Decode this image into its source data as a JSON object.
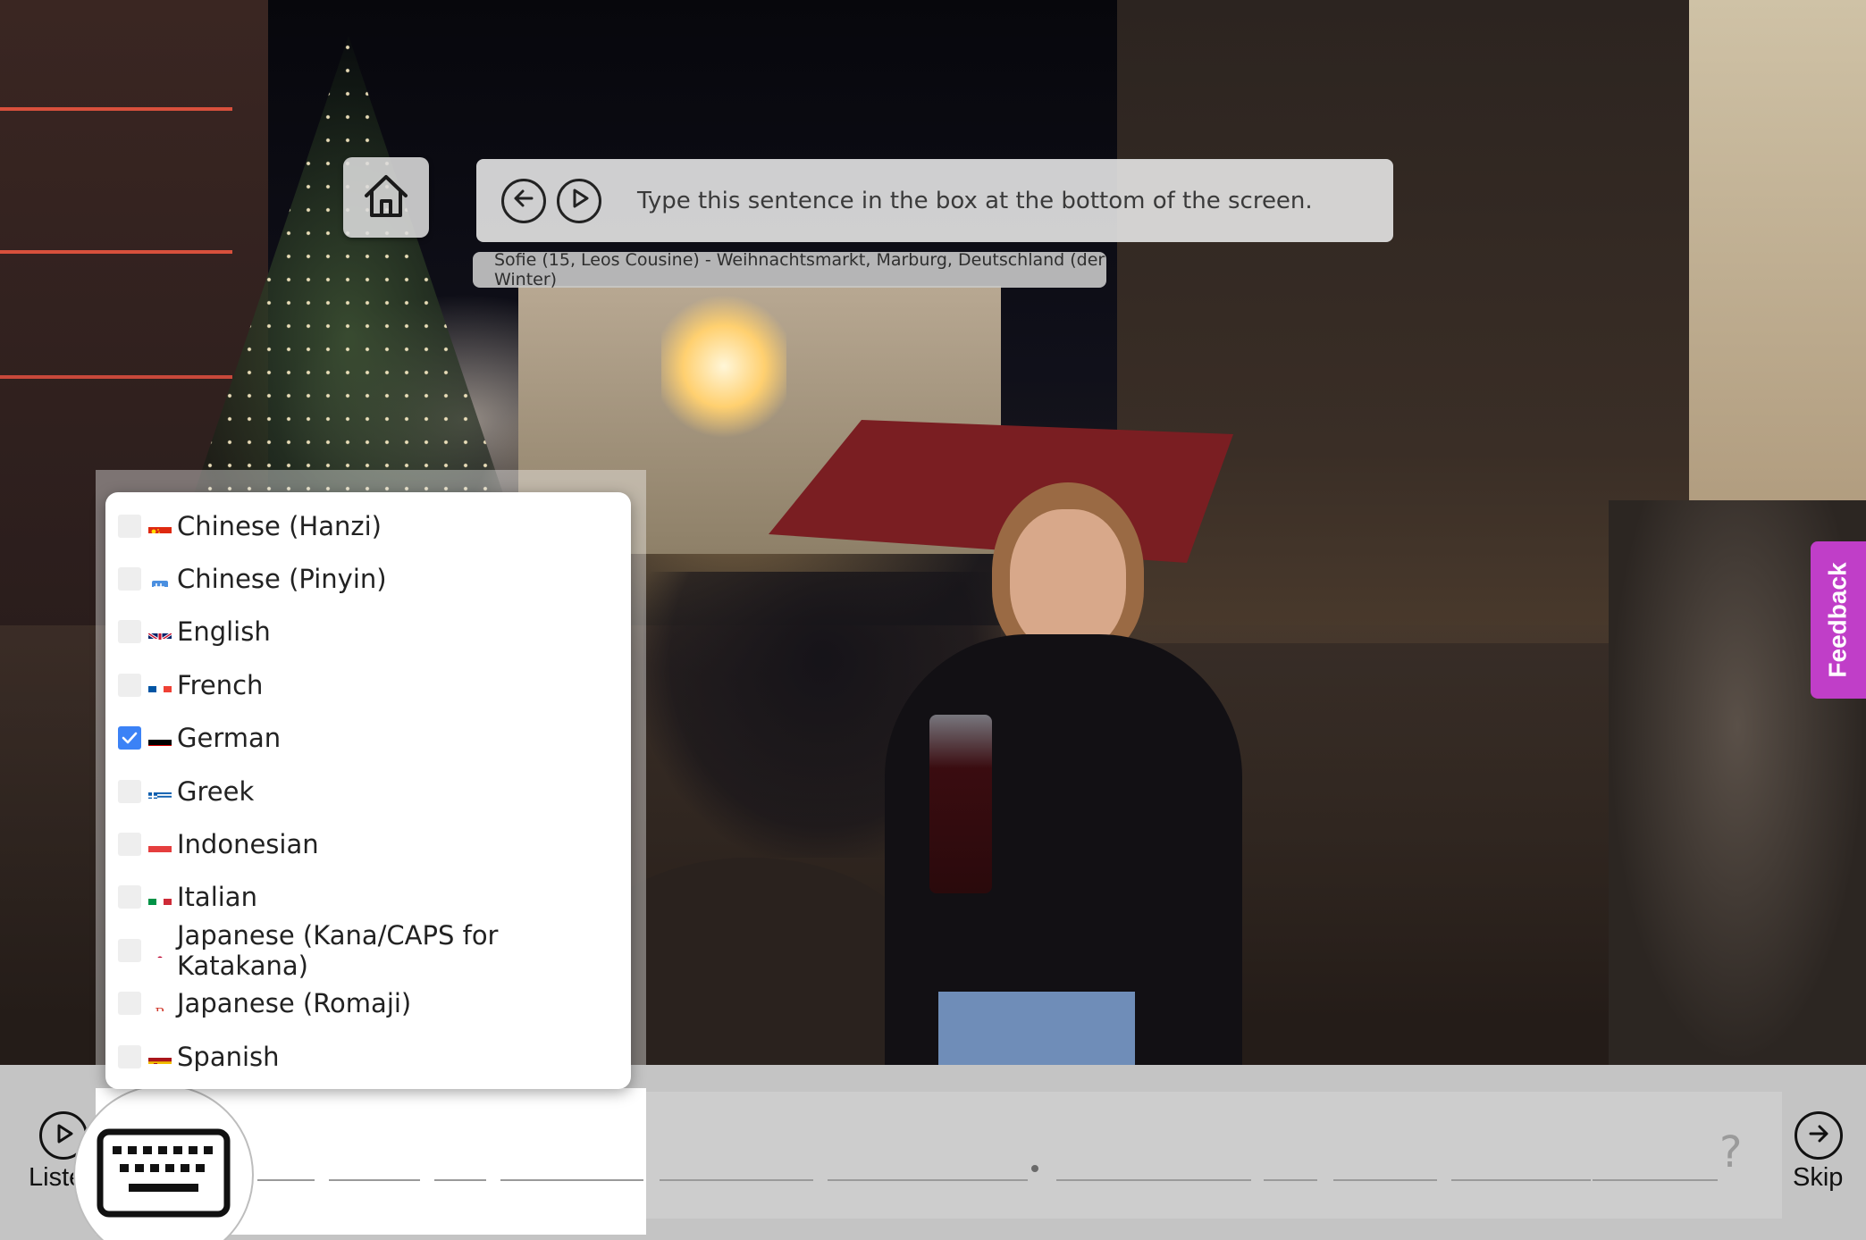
{
  "header": {
    "instruction": "Type this sentence in the box at the bottom of the screen.",
    "speaker": "Sofie (15, Leos Cousine) - Weihnachtsmarkt, Marburg, Deutschland (der Winter)"
  },
  "icons": {
    "home": "home-icon",
    "back": "arrow-left-circle-icon",
    "play": "play-circle-icon",
    "listen": "play-circle-icon",
    "skip": "arrow-right-circle-icon",
    "keyboard": "keyboard-icon"
  },
  "language_menu": {
    "items": [
      {
        "label": "Chinese (Hanzi)",
        "checked": false,
        "flag": "cn"
      },
      {
        "label": "Chinese (Pinyin)",
        "checked": false,
        "flag": "pinyin"
      },
      {
        "label": "English",
        "checked": false,
        "flag": "gb"
      },
      {
        "label": "French",
        "checked": false,
        "flag": "fr"
      },
      {
        "label": "German",
        "checked": true,
        "flag": "de"
      },
      {
        "label": "Greek",
        "checked": false,
        "flag": "gr"
      },
      {
        "label": "Indonesian",
        "checked": false,
        "flag": "id"
      },
      {
        "label": "Italian",
        "checked": false,
        "flag": "it"
      },
      {
        "label": "Japanese (Kana/CAPS for Katakana)",
        "checked": false,
        "flag": "jp"
      },
      {
        "label": "Japanese (Romaji)",
        "checked": false,
        "flag": "romaji"
      },
      {
        "label": "Spanish",
        "checked": false,
        "flag": "es"
      }
    ]
  },
  "bottom": {
    "listen_label": "Listen",
    "skip_label": "Skip",
    "hint": "?"
  },
  "feedback": {
    "label": "Feedback"
  },
  "colors": {
    "accent_checkbox": "#3b82f6",
    "feedback": "#c03ec8"
  }
}
